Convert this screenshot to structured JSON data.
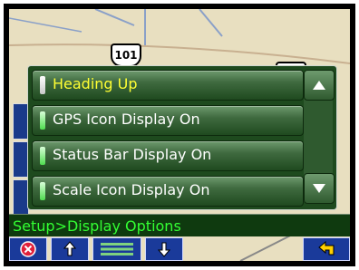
{
  "map": {
    "route_shield": "101"
  },
  "menu": {
    "items": [
      {
        "label": "Heading Up",
        "state": "off",
        "selected": true
      },
      {
        "label": "GPS Icon Display On",
        "state": "on",
        "selected": false
      },
      {
        "label": "Status Bar Display On",
        "state": "on",
        "selected": false
      },
      {
        "label": "Scale Icon Display On",
        "state": "on",
        "selected": false
      }
    ],
    "scroll_up_icon": "up-triangle",
    "scroll_down_icon": "down-triangle"
  },
  "status": {
    "breadcrumb": "Setup>Display Options"
  },
  "toolbar": {
    "buttons": [
      {
        "name": "close-button",
        "icon": "circle-x-icon"
      },
      {
        "name": "page-up-button",
        "icon": "up-arrow-icon"
      },
      {
        "name": "list-menu-button",
        "icon": "list-icon"
      },
      {
        "name": "page-down-button",
        "icon": "down-arrow-icon"
      },
      {
        "name": "back-button",
        "icon": "return-arrow-icon"
      }
    ]
  },
  "colors": {
    "accent_green": "#33ff33",
    "selected_yellow": "#ffff33",
    "toolbar_blue": "#1a3a9a"
  }
}
